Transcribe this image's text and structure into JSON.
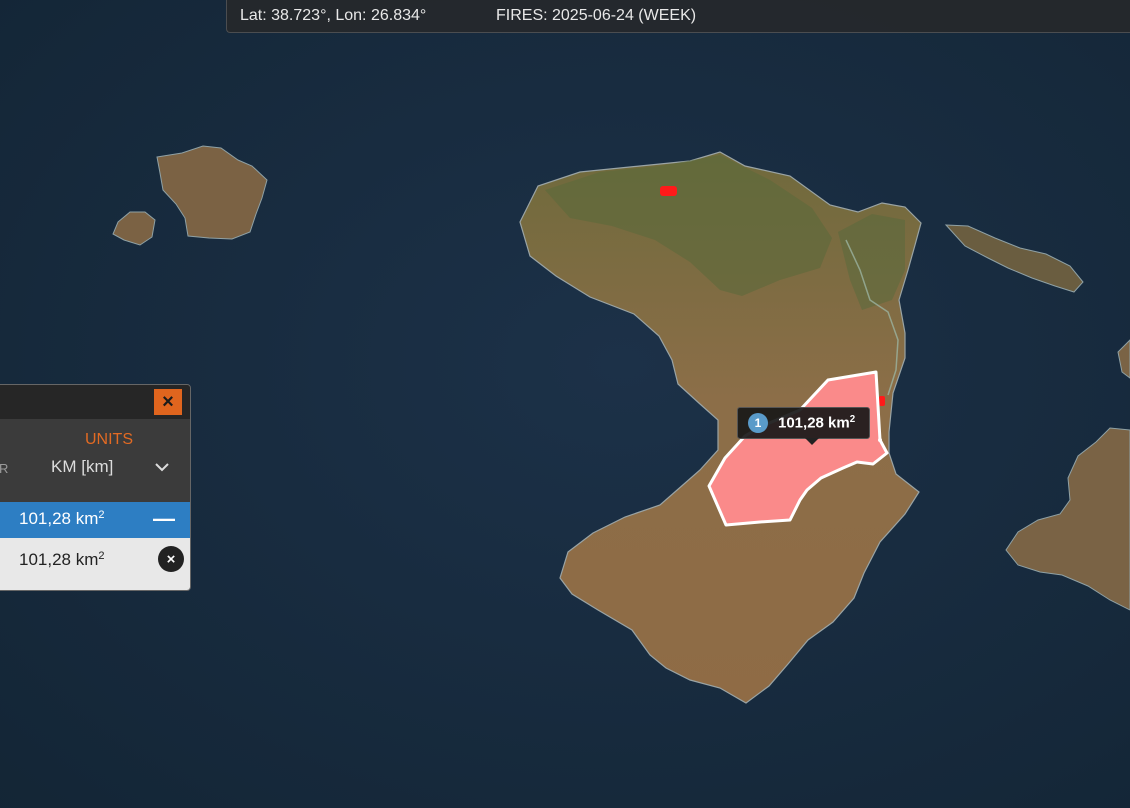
{
  "status_bar": {
    "coords": "Lat: 38.723°, Lon: 26.834°",
    "fires": "FIRES: 2025-06-24 (WEEK)"
  },
  "measure_tooltip": {
    "index": "1",
    "area_value": "101,28 km",
    "area_exp": "2"
  },
  "measure_panel": {
    "close_symbol": "×",
    "units_label": "UNITS",
    "units_value": "KM [km]",
    "units_cut_label": "R",
    "total_value": "101,28 km",
    "total_exp": "2",
    "total_action": "—",
    "item_value": "101,28 km",
    "item_exp": "2",
    "item_remove_symbol": "×"
  },
  "colors": {
    "sea": "#16283a",
    "land": "#8a6a45",
    "burn_area_fill": "#fa8a8a",
    "fire_hotspot": "#ff1a1a",
    "panel_accent": "#e26a23",
    "selected_row": "#2d7ec3"
  },
  "icons": {
    "close": "close-icon",
    "dropdown": "chevron-down-icon",
    "collapse": "minus-icon",
    "remove": "close-circle-icon"
  }
}
